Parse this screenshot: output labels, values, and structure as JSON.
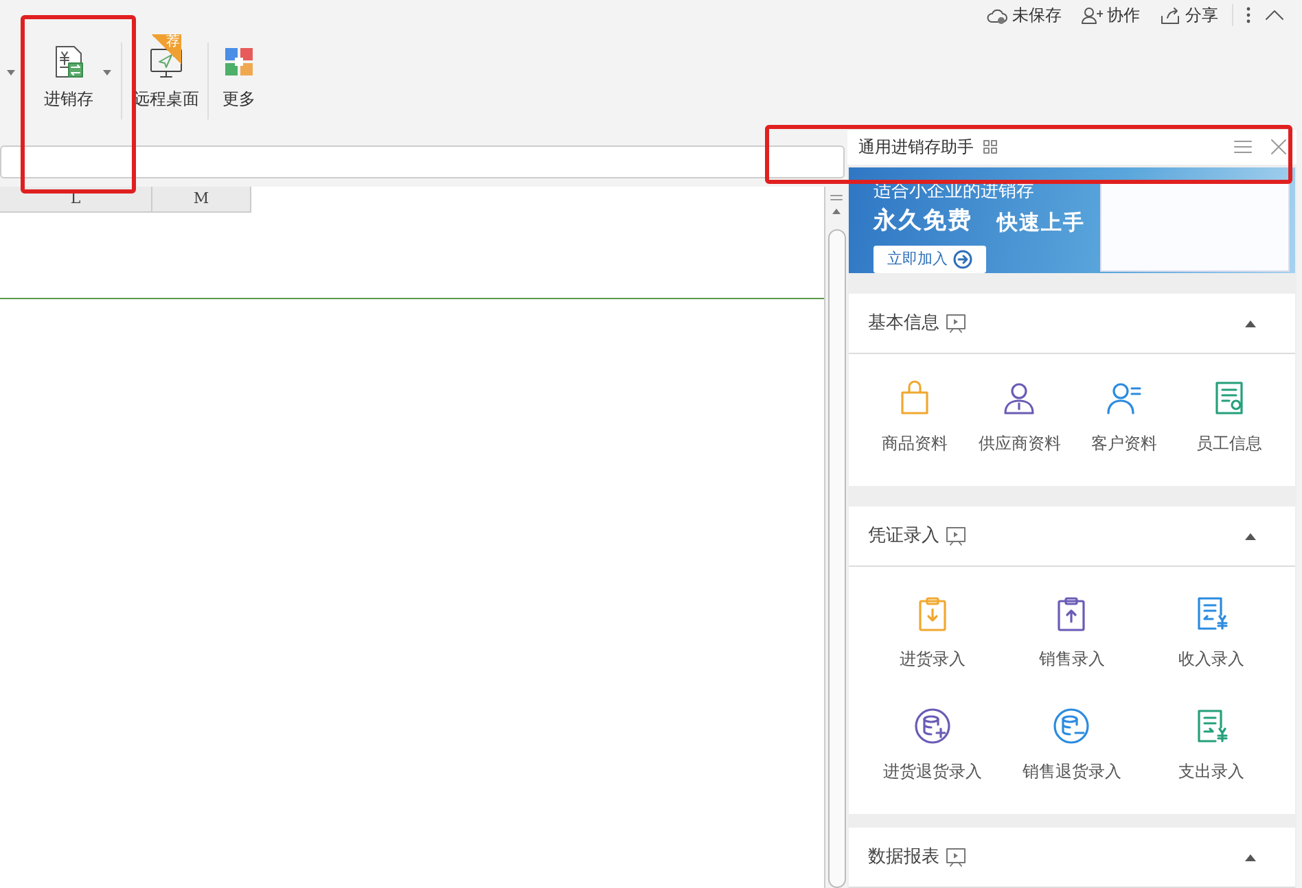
{
  "title_bar": {
    "actions": [
      {
        "label": "未保存"
      },
      {
        "label": "协作"
      },
      {
        "label": "分享"
      }
    ]
  },
  "ribbon": {
    "buttons": [
      {
        "label": "进销存",
        "dropdown": true
      },
      {
        "label": "远程桌面",
        "badge": "荐",
        "dropdown": false
      },
      {
        "label": "更多",
        "dropdown": false
      }
    ]
  },
  "sheet": {
    "columns": [
      "L",
      "M"
    ]
  },
  "panel": {
    "title": "通用进销存助手",
    "banner": {
      "subtitle": "适合小企业的进销存",
      "headline": [
        "永久免费",
        "快速上手"
      ],
      "button": "立即加入"
    },
    "sections": [
      {
        "title": "基本信息",
        "expanded": true,
        "items": [
          {
            "label": "商品资料"
          },
          {
            "label": "供应商资料"
          },
          {
            "label": "客户资料"
          },
          {
            "label": "员工信息"
          }
        ]
      },
      {
        "title": "凭证录入",
        "expanded": true,
        "items": [
          {
            "label": "进货录入"
          },
          {
            "label": "销售录入"
          },
          {
            "label": "收入录入"
          },
          {
            "label": "进货退货录入"
          },
          {
            "label": "销售退货录入"
          },
          {
            "label": "支出录入"
          }
        ]
      },
      {
        "title": "数据报表",
        "expanded": true
      }
    ]
  }
}
